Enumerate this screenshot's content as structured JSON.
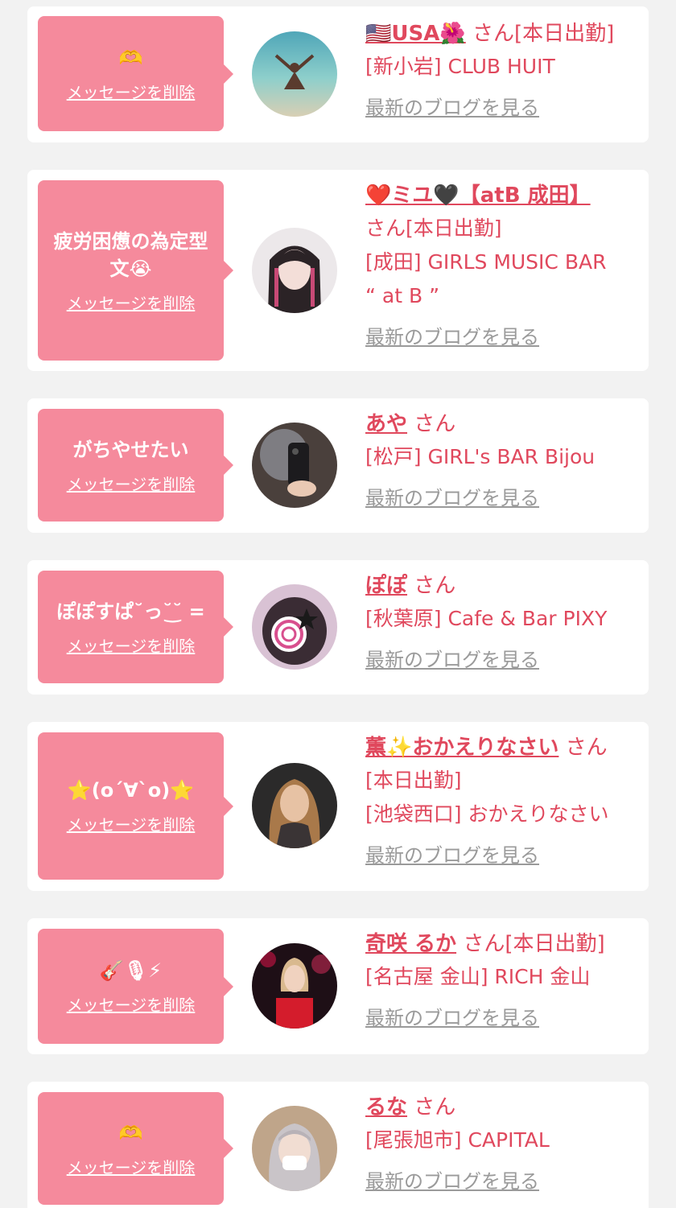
{
  "items": [
    {
      "message": "🫶",
      "delete_label": "メッセージを削除",
      "name": "🇺🇸USA🌺",
      "suffix": " さん[本日出勤]",
      "shop_lines": [
        "[新小岩] CLUB HUIT"
      ],
      "blog_label": "最新のブログを見る"
    },
    {
      "message": "疲労困憊の為定型文😭",
      "delete_label": "メッセージを削除",
      "name": "❤️ミユ🖤【atB 成田】",
      "suffix": "",
      "shop_lines": [
        "さん[本日出勤]",
        "[成田] GIRLS MUSIC BAR",
        "“ at B ”"
      ],
      "blog_label": "最新のブログを見る"
    },
    {
      "message": "がちやせたい",
      "delete_label": "メッセージを削除",
      "name": "あや",
      "suffix": " さん",
      "shop_lines": [
        "[松戸] GIRL's BAR Bijou"
      ],
      "blog_label": "最新のブログを見る"
    },
    {
      "message": "ぽぽすぱ˘っ˘͜˘ =",
      "delete_label": "メッセージを削除",
      "name": "ぽぽ",
      "suffix": " さん",
      "shop_lines": [
        "[秋葉原] Cafe & Bar PIXY"
      ],
      "blog_label": "最新のブログを見る"
    },
    {
      "message": "⭐(o´∀`o)⭐",
      "delete_label": "メッセージを削除",
      "name": "薫✨おかえりなさい",
      "suffix": " さん",
      "shop_lines": [
        "[本日出勤]",
        "[池袋西口] おかえりなさい"
      ],
      "blog_label": "最新のブログを見る"
    },
    {
      "message": "🎸🎙⚡",
      "delete_label": "メッセージを削除",
      "name": "奇咲 るか",
      "suffix": " さん[本日出勤]",
      "shop_lines": [
        "[名古屋 金山] RICH 金山"
      ],
      "blog_label": "最新のブログを見る"
    },
    {
      "message": "🫶",
      "delete_label": "メッセージを削除",
      "name": "るな",
      "suffix": " さん",
      "shop_lines": [
        "[尾張旭市] CAPITAL"
      ],
      "blog_label": "最新のブログを見る"
    }
  ]
}
